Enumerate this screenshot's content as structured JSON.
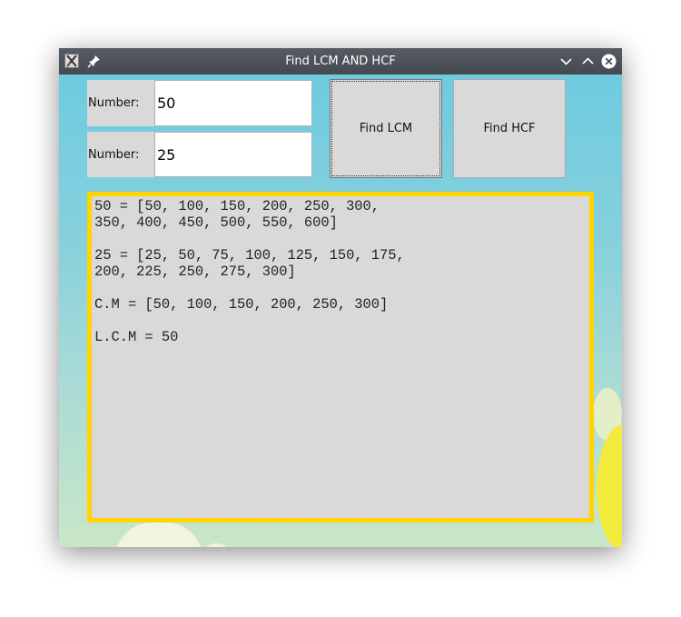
{
  "window": {
    "title": "Find LCM AND HCF"
  },
  "form": {
    "number1": {
      "label": "Number:",
      "value": "50"
    },
    "number2": {
      "label": "Number:",
      "value": "25"
    }
  },
  "buttons": {
    "lcm_label": "Find LCM",
    "hcf_label": "Find HCF"
  },
  "result": {
    "lines": [
      "50 = [50, 100, 150, 200, 250, 300,",
      "350, 400, 450, 500, 550, 600]",
      "",
      "25 = [25, 50, 75, 100, 125, 150, 175,",
      "200, 225, 250, 275, 300]",
      "",
      "C.M = [50, 100, 150, 200, 250, 300]",
      "",
      "L.C.M = 50"
    ]
  },
  "colors": {
    "result_border": "#ffd400",
    "widget_bg": "#d9d9d9"
  },
  "icons": [
    "app-icon",
    "pin-icon",
    "minimize-icon",
    "maximize-icon",
    "close-icon"
  ]
}
